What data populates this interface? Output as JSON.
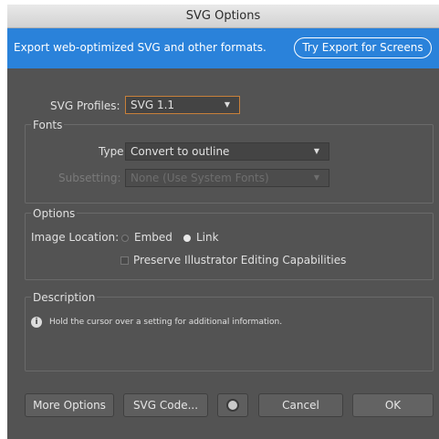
{
  "window": {
    "title": "SVG Options"
  },
  "banner": {
    "text": "Export web-optimized SVG and other formats.",
    "button_label": "Try Export for Screens"
  },
  "profiles": {
    "label": "SVG Profiles:",
    "value": "SVG 1.1"
  },
  "fonts": {
    "title": "Fonts",
    "type_label": "Type:",
    "type_value": "Convert to outline",
    "subsetting_label": "Subsetting:",
    "subsetting_value": "None (Use System Fonts)"
  },
  "options": {
    "title": "Options",
    "image_location_label": "Image Location:",
    "embed_label": "Embed",
    "link_label": "Link",
    "selected": "Link",
    "preserve_label": "Preserve Illustrator Editing Capabilities",
    "preserve_checked": false
  },
  "description": {
    "title": "Description",
    "text": "Hold the cursor over a setting for additional information."
  },
  "footer": {
    "more_options": "More Options",
    "svg_code": "SVG Code...",
    "cancel": "Cancel",
    "ok": "OK"
  },
  "icons": {
    "dropdown": "chevron-down-icon",
    "info": "info-icon",
    "globe": "globe-icon"
  },
  "colors": {
    "banner": "#2a82da",
    "dialog_bg": "#535353",
    "focus_border": "#c8803a"
  }
}
